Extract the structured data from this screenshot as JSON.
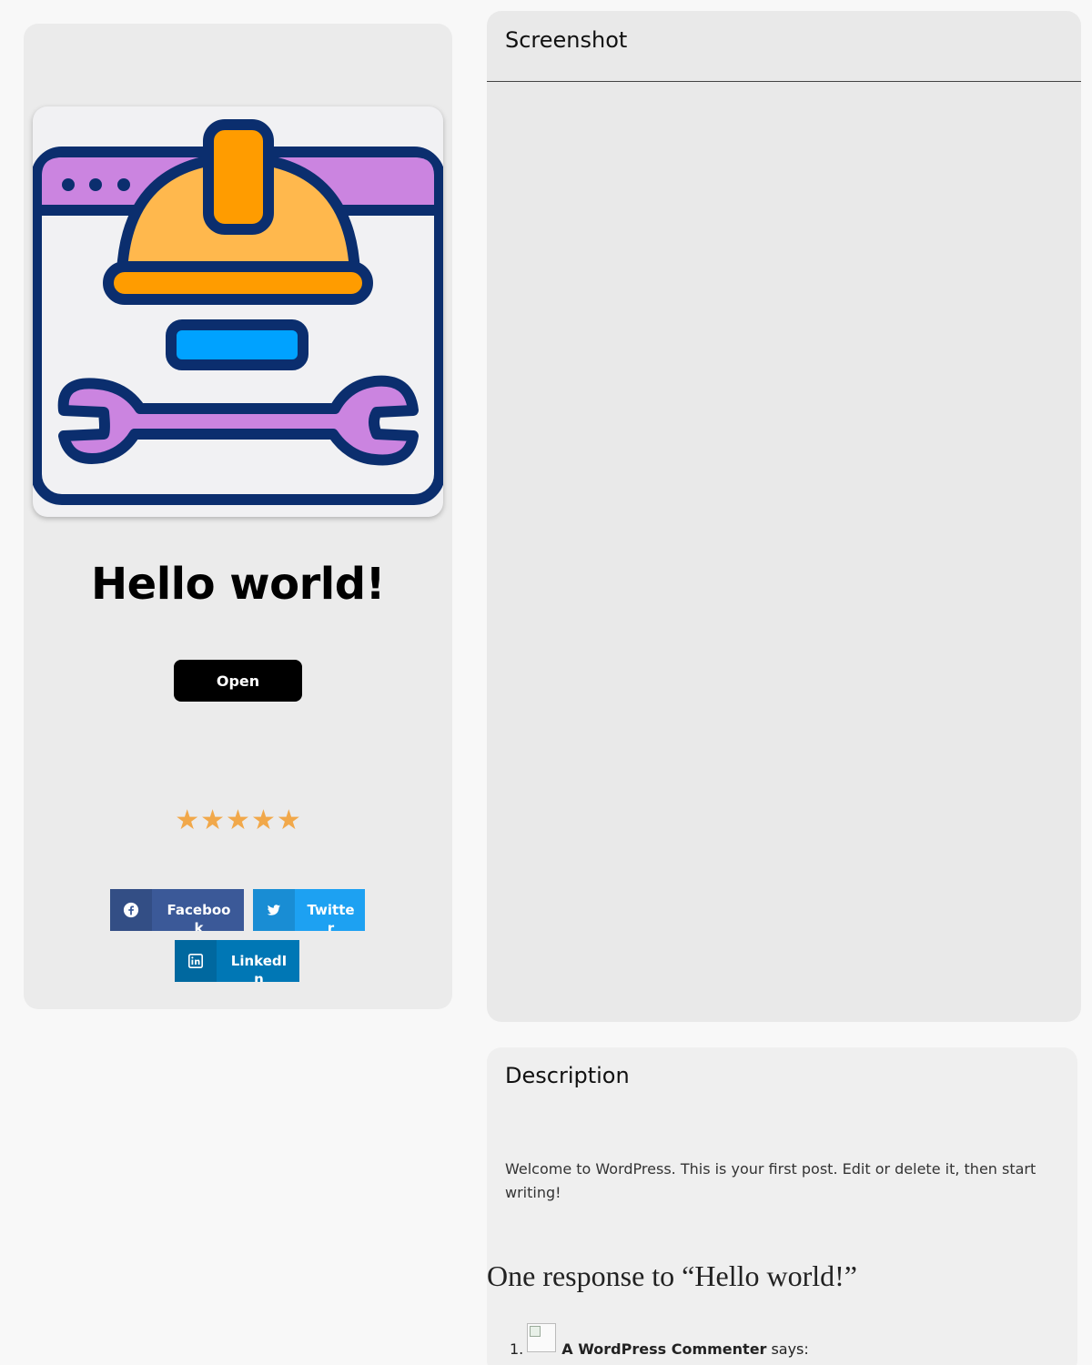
{
  "post": {
    "title": "Hello world!",
    "open_label": "Open",
    "rating_stars": 5,
    "rating_star_glyph": "★",
    "app_icon": "construction-maintenance-icon"
  },
  "share": {
    "facebook": {
      "label": "Facebook",
      "icon": "facebook-icon",
      "color": "#3b5998"
    },
    "twitter": {
      "label": "Twitter",
      "icon": "twitter-icon",
      "color": "#1da1f2"
    },
    "linkedin": {
      "label": "LinkedIn",
      "icon": "linkedin-icon",
      "color": "#0077b5"
    }
  },
  "screenshot": {
    "heading": "Screenshot"
  },
  "description": {
    "heading": "Description",
    "text": "Welcome to WordPress. This is your first post. Edit or delete it, then start writing!"
  },
  "comments": {
    "title": "One response to “Hello world!”",
    "items": [
      {
        "number": "1.",
        "author": "A WordPress Commenter",
        "says": "says:"
      }
    ]
  },
  "colors": {
    "star": "#f1a84a",
    "button_bg": "#000000",
    "page_bg": "#f8f8f8",
    "card_bg": "#ebebeb"
  }
}
